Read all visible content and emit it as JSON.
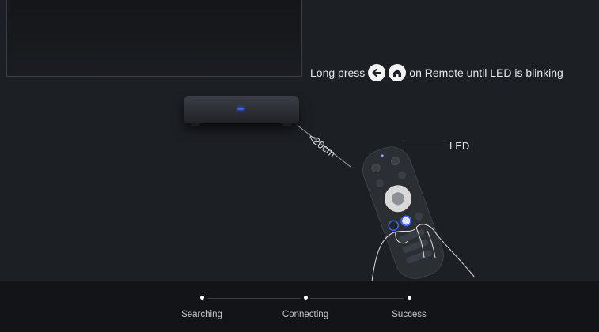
{
  "instruction": {
    "prefix": "Long press",
    "back_icon": "arrow-left-icon",
    "home_icon": "home-icon",
    "suffix": "on Remote until LED is blinking"
  },
  "distance_label": "<20cm",
  "led_label": "LED",
  "steps": [
    {
      "label": "Searching"
    },
    {
      "label": "Connecting"
    },
    {
      "label": "Success"
    }
  ],
  "colors": {
    "background": "#1c1f24",
    "bottom_bar": "#121417",
    "led_blue": "#3b62ff",
    "text": "#e6e6e6"
  }
}
